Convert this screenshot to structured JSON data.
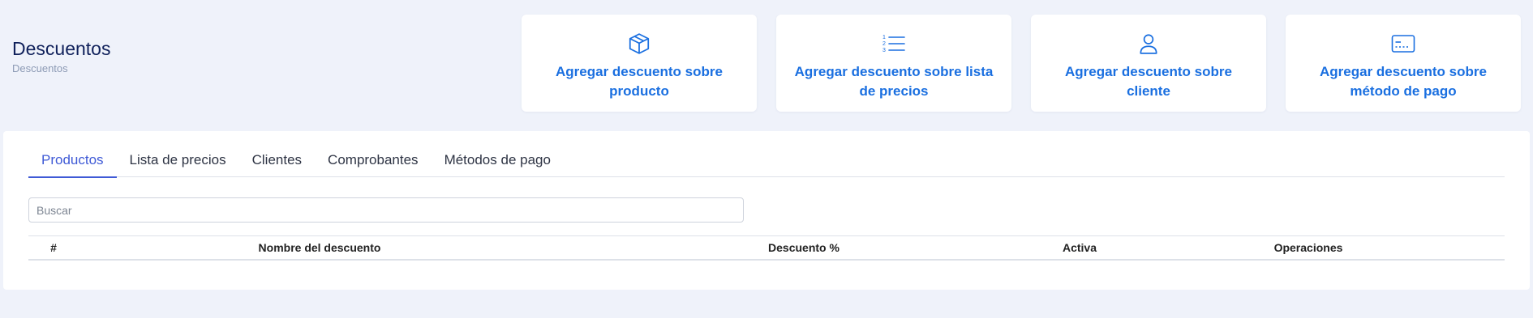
{
  "header": {
    "title": "Descuentos",
    "breadcrumb": "Descuentos"
  },
  "actions": [
    {
      "label": "Agregar descuento sobre producto",
      "icon": "box-icon"
    },
    {
      "label": "Agregar descuento sobre lista de precios",
      "icon": "numbered-list-icon"
    },
    {
      "label": "Agregar descuento sobre cliente",
      "icon": "user-icon"
    },
    {
      "label": "Agregar descuento sobre método de pago",
      "icon": "payment-card-icon"
    }
  ],
  "tabs": [
    {
      "label": "Productos",
      "active": true
    },
    {
      "label": "Lista de precios",
      "active": false
    },
    {
      "label": "Clientes",
      "active": false
    },
    {
      "label": "Comprobantes",
      "active": false
    },
    {
      "label": "Métodos de pago",
      "active": false
    }
  ],
  "search": {
    "placeholder": "Buscar",
    "value": ""
  },
  "table": {
    "columns": [
      "#",
      "Nombre del descuento",
      "Descuento %",
      "Activa",
      "Operaciones"
    ],
    "rows": []
  },
  "colors": {
    "accent": "#1a6fe0",
    "active_tab": "#3f5ad6",
    "title": "#10215b",
    "background": "#eff2fa"
  }
}
